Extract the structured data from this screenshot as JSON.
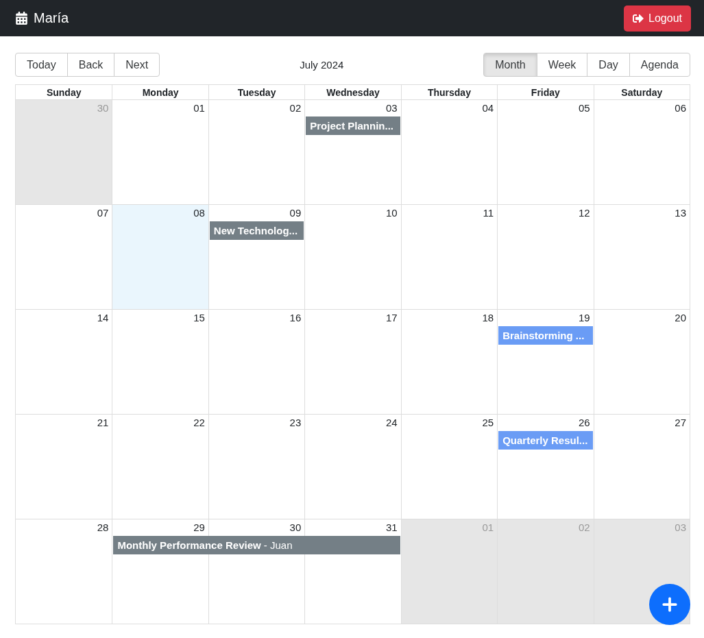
{
  "navbar": {
    "user": "María",
    "logout": "Logout"
  },
  "toolbar": {
    "nav_buttons": [
      "Today",
      "Back",
      "Next"
    ],
    "label": "July 2024",
    "views": [
      {
        "label": "Month",
        "selected": true
      },
      {
        "label": "Week",
        "selected": false
      },
      {
        "label": "Day",
        "selected": false
      },
      {
        "label": "Agenda",
        "selected": false
      }
    ]
  },
  "weekdays": [
    "Sunday",
    "Monday",
    "Tuesday",
    "Wednesday",
    "Thursday",
    "Friday",
    "Saturday"
  ],
  "weeks": [
    {
      "days": [
        {
          "date": "30",
          "off_range": true,
          "today": false
        },
        {
          "date": "01",
          "off_range": false,
          "today": false
        },
        {
          "date": "02",
          "off_range": false,
          "today": false
        },
        {
          "date": "03",
          "off_range": false,
          "today": false,
          "events": [
            {
              "kind": "start",
              "title": "Project Plannin...",
              "color": "#747f86"
            }
          ]
        },
        {
          "date": "04",
          "off_range": false,
          "today": false
        },
        {
          "date": "05",
          "off_range": false,
          "today": false
        },
        {
          "date": "06",
          "off_range": false,
          "today": false
        }
      ]
    },
    {
      "days": [
        {
          "date": "07",
          "off_range": false,
          "today": false
        },
        {
          "date": "08",
          "off_range": false,
          "today": true
        },
        {
          "date": "09",
          "off_range": false,
          "today": false,
          "events": [
            {
              "kind": "start",
              "title": "New Technolog...",
              "color": "#747f86"
            }
          ]
        },
        {
          "date": "10",
          "off_range": false,
          "today": false
        },
        {
          "date": "11",
          "off_range": false,
          "today": false
        },
        {
          "date": "12",
          "off_range": false,
          "today": false
        },
        {
          "date": "13",
          "off_range": false,
          "today": false
        }
      ]
    },
    {
      "days": [
        {
          "date": "14",
          "off_range": false,
          "today": false
        },
        {
          "date": "15",
          "off_range": false,
          "today": false
        },
        {
          "date": "16",
          "off_range": false,
          "today": false
        },
        {
          "date": "17",
          "off_range": false,
          "today": false
        },
        {
          "date": "18",
          "off_range": false,
          "today": false
        },
        {
          "date": "19",
          "off_range": false,
          "today": false,
          "events": [
            {
              "kind": "start",
              "title": "Brainstorming ...",
              "color": "#6a9cf5"
            }
          ]
        },
        {
          "date": "20",
          "off_range": false,
          "today": false
        }
      ]
    },
    {
      "days": [
        {
          "date": "21",
          "off_range": false,
          "today": false
        },
        {
          "date": "22",
          "off_range": false,
          "today": false
        },
        {
          "date": "23",
          "off_range": false,
          "today": false
        },
        {
          "date": "24",
          "off_range": false,
          "today": false
        },
        {
          "date": "25",
          "off_range": false,
          "today": false
        },
        {
          "date": "26",
          "off_range": false,
          "today": false,
          "events": [
            {
              "kind": "start",
              "title": "Quarterly Resul...",
              "color": "#6a9cf5"
            }
          ]
        },
        {
          "date": "27",
          "off_range": false,
          "today": false
        }
      ]
    },
    {
      "days": [
        {
          "date": "28",
          "off_range": false,
          "today": false
        },
        {
          "date": "29",
          "off_range": false,
          "today": false,
          "events": [
            {
              "kind": "start",
              "title": "**Monthly Performance Review** - Juan",
              "color": "#747f86"
            }
          ]
        },
        {
          "date": "30",
          "off_range": false,
          "today": false,
          "events": [
            {
              "kind": "continued"
            }
          ]
        },
        {
          "date": "31",
          "off_range": false,
          "today": false,
          "events": [
            {
              "kind": "continued"
            }
          ]
        },
        {
          "date": "01",
          "off_range": true,
          "today": false
        },
        {
          "date": "02",
          "off_range": true,
          "today": false
        },
        {
          "date": "03",
          "off_range": true,
          "today": false
        }
      ]
    }
  ]
}
